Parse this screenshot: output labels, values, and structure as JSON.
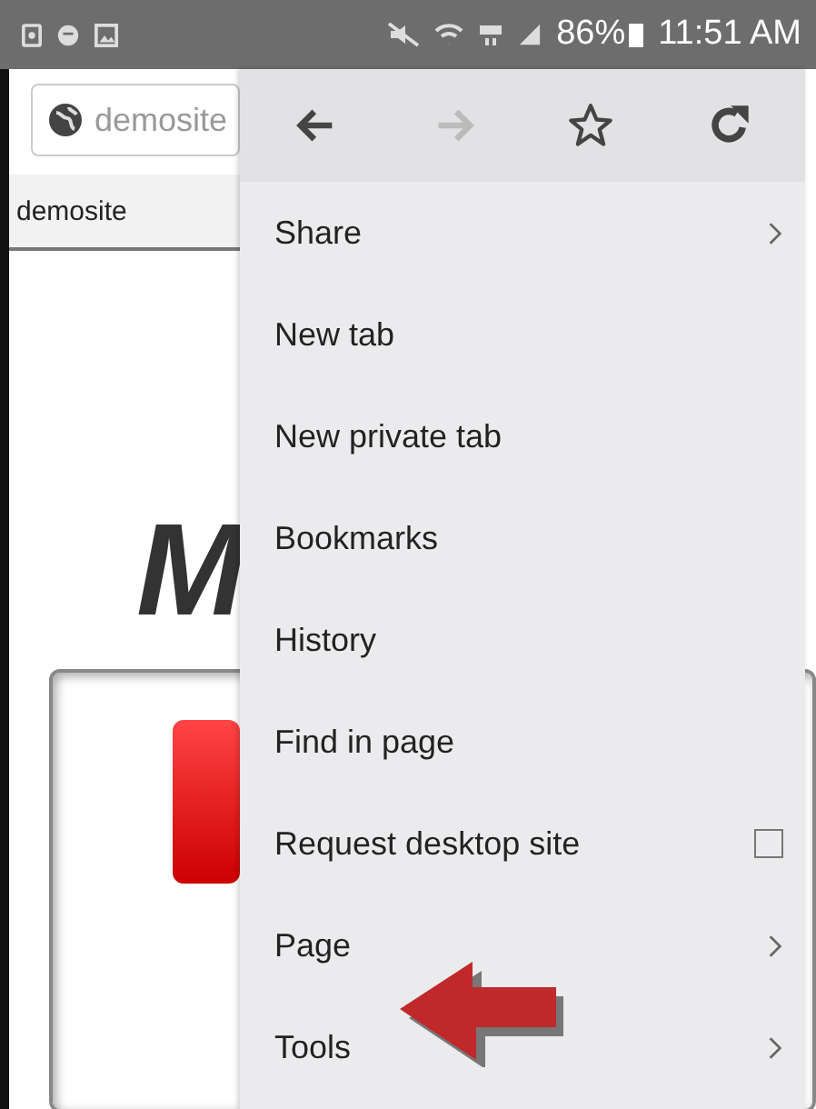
{
  "status_bar": {
    "battery": "86%",
    "time": "11:51 AM"
  },
  "address_bar": {
    "value": "demosite"
  },
  "tab": {
    "title": "demosite"
  },
  "page": {
    "heading": "M"
  },
  "menu": {
    "toolbar": [
      {
        "kind": "back",
        "disabled": false
      },
      {
        "kind": "forward",
        "disabled": true
      },
      {
        "kind": "bookmark",
        "disabled": false
      },
      {
        "kind": "reload",
        "disabled": false
      }
    ],
    "items": [
      {
        "label": "Share",
        "kind": "submenu"
      },
      {
        "label": "New tab",
        "kind": "plain"
      },
      {
        "label": "New private tab",
        "kind": "plain"
      },
      {
        "label": "Bookmarks",
        "kind": "plain"
      },
      {
        "label": "History",
        "kind": "plain"
      },
      {
        "label": "Find in page",
        "kind": "plain"
      },
      {
        "label": "Request desktop site",
        "kind": "checkbox",
        "checked": false
      },
      {
        "label": "Page",
        "kind": "submenu"
      },
      {
        "label": "Tools",
        "kind": "submenu"
      }
    ]
  }
}
